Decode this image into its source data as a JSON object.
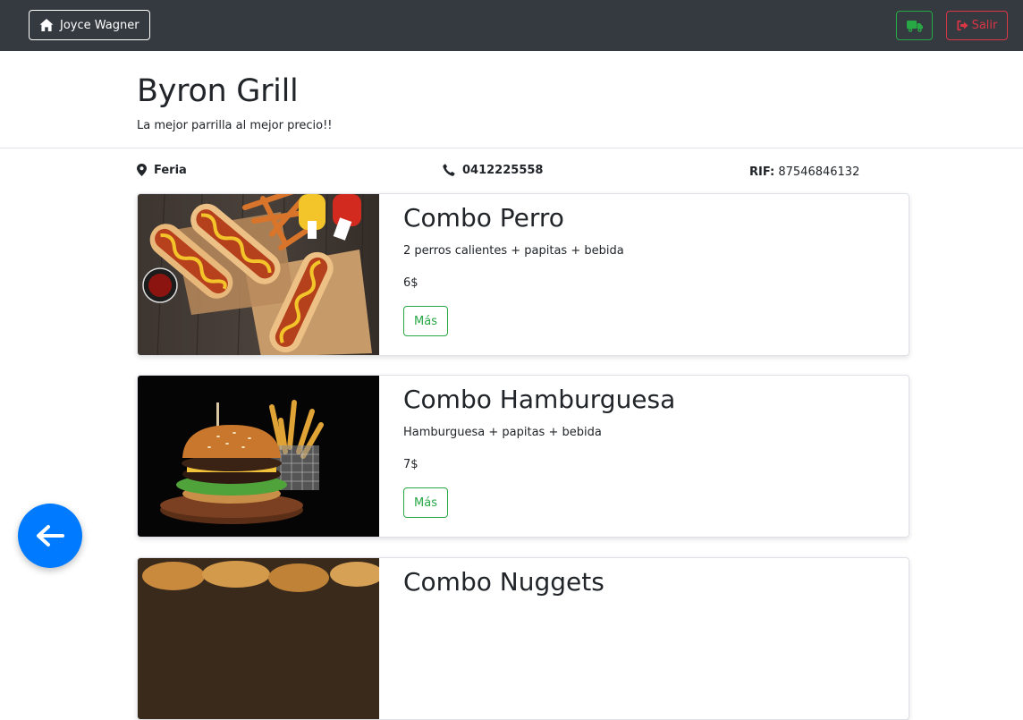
{
  "navbar": {
    "user_name": "Joyce Wagner",
    "user_icon": "home-icon",
    "orders_icon": "truck-icon",
    "exit_label": "Salir",
    "exit_icon": "sign-out-icon",
    "bg_color": "#343a40",
    "success_color": "#28a745",
    "danger_color": "#dc3545"
  },
  "restaurant": {
    "name": "Byron Grill",
    "slogan": "La mejor parrilla al mejor precio!!",
    "location": "Feria",
    "phone": "0412225558",
    "rif_label": "RIF:",
    "rif_value": "87546846132"
  },
  "menu": {
    "more_label": "Más",
    "items": [
      {
        "title": "Combo Perro",
        "description": "2 perros calientes + papitas + bebida",
        "price": "6$"
      },
      {
        "title": "Combo Hamburguesa",
        "description": "Hamburguesa + papitas + bebida",
        "price": "7$"
      },
      {
        "title": "Combo Nuggets"
      }
    ]
  },
  "fab": {
    "icon": "arrow-left-icon",
    "color": "#007bff"
  }
}
